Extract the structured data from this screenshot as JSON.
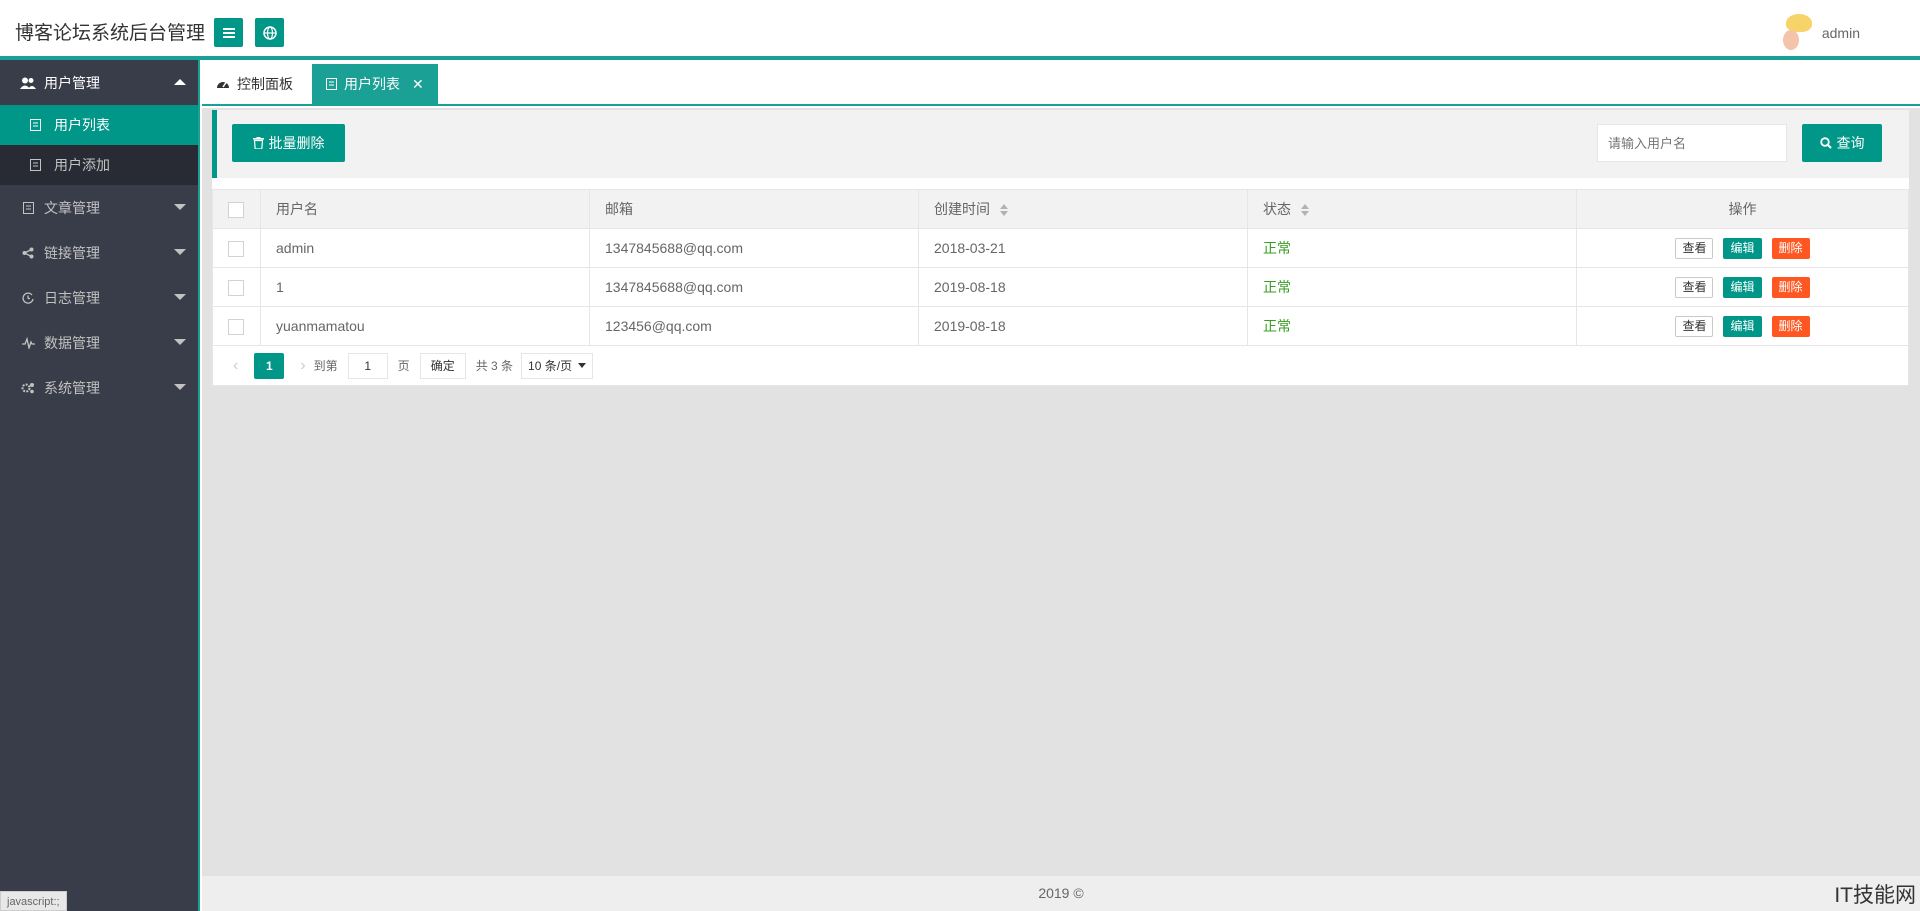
{
  "header": {
    "title": "博客论坛系统后台管理",
    "menu_icon": "menu-icon",
    "globe_icon": "globe-icon",
    "username": "admin"
  },
  "sidebar": {
    "groups": [
      {
        "label": "用户管理",
        "icon": "users-icon",
        "open": true,
        "children": [
          {
            "label": "用户列表",
            "active": true
          },
          {
            "label": "用户添加",
            "active": false
          }
        ]
      },
      {
        "label": "文章管理",
        "icon": "article-icon"
      },
      {
        "label": "链接管理",
        "icon": "share-icon"
      },
      {
        "label": "日志管理",
        "icon": "log-icon"
      },
      {
        "label": "数据管理",
        "icon": "pulse-icon"
      },
      {
        "label": "系统管理",
        "icon": "gears-icon"
      }
    ]
  },
  "statusbar": "javascript:;",
  "tabs": [
    {
      "label": "控制面板",
      "icon": "dashboard-icon",
      "active": false
    },
    {
      "label": "用户列表",
      "icon": "list-icon",
      "active": true,
      "close": "✕"
    }
  ],
  "toolbar": {
    "batch_delete": "批量删除",
    "search_placeholder": "请输入用户名",
    "search_button": "查询"
  },
  "table": {
    "columns": [
      "用户名",
      "邮箱",
      "创建时间",
      "状态",
      "操作"
    ],
    "rows": [
      {
        "username": "admin",
        "email": "1347845688@qq.com",
        "created": "2018-03-21",
        "status": "正常"
      },
      {
        "username": "1",
        "email": "1347845688@qq.com",
        "created": "2019-08-18",
        "status": "正常"
      },
      {
        "username": "yuanmamatou",
        "email": "123456@qq.com",
        "created": "2019-08-18",
        "status": "正常"
      }
    ],
    "actions": {
      "view": "查看",
      "edit": "编辑",
      "delete": "删除"
    }
  },
  "pager": {
    "prev": "‹",
    "current": "1",
    "next": "›",
    "goto_label": "到第",
    "goto_value": "1",
    "page_label": "页",
    "confirm": "确定",
    "total": "共 3 条",
    "page_size": "10 条/页"
  },
  "footer": "2019 ©",
  "watermark": "IT技能网",
  "colors": {
    "accent": "#009688",
    "sidebar": "#393d49",
    "danger": "#ff5722"
  }
}
